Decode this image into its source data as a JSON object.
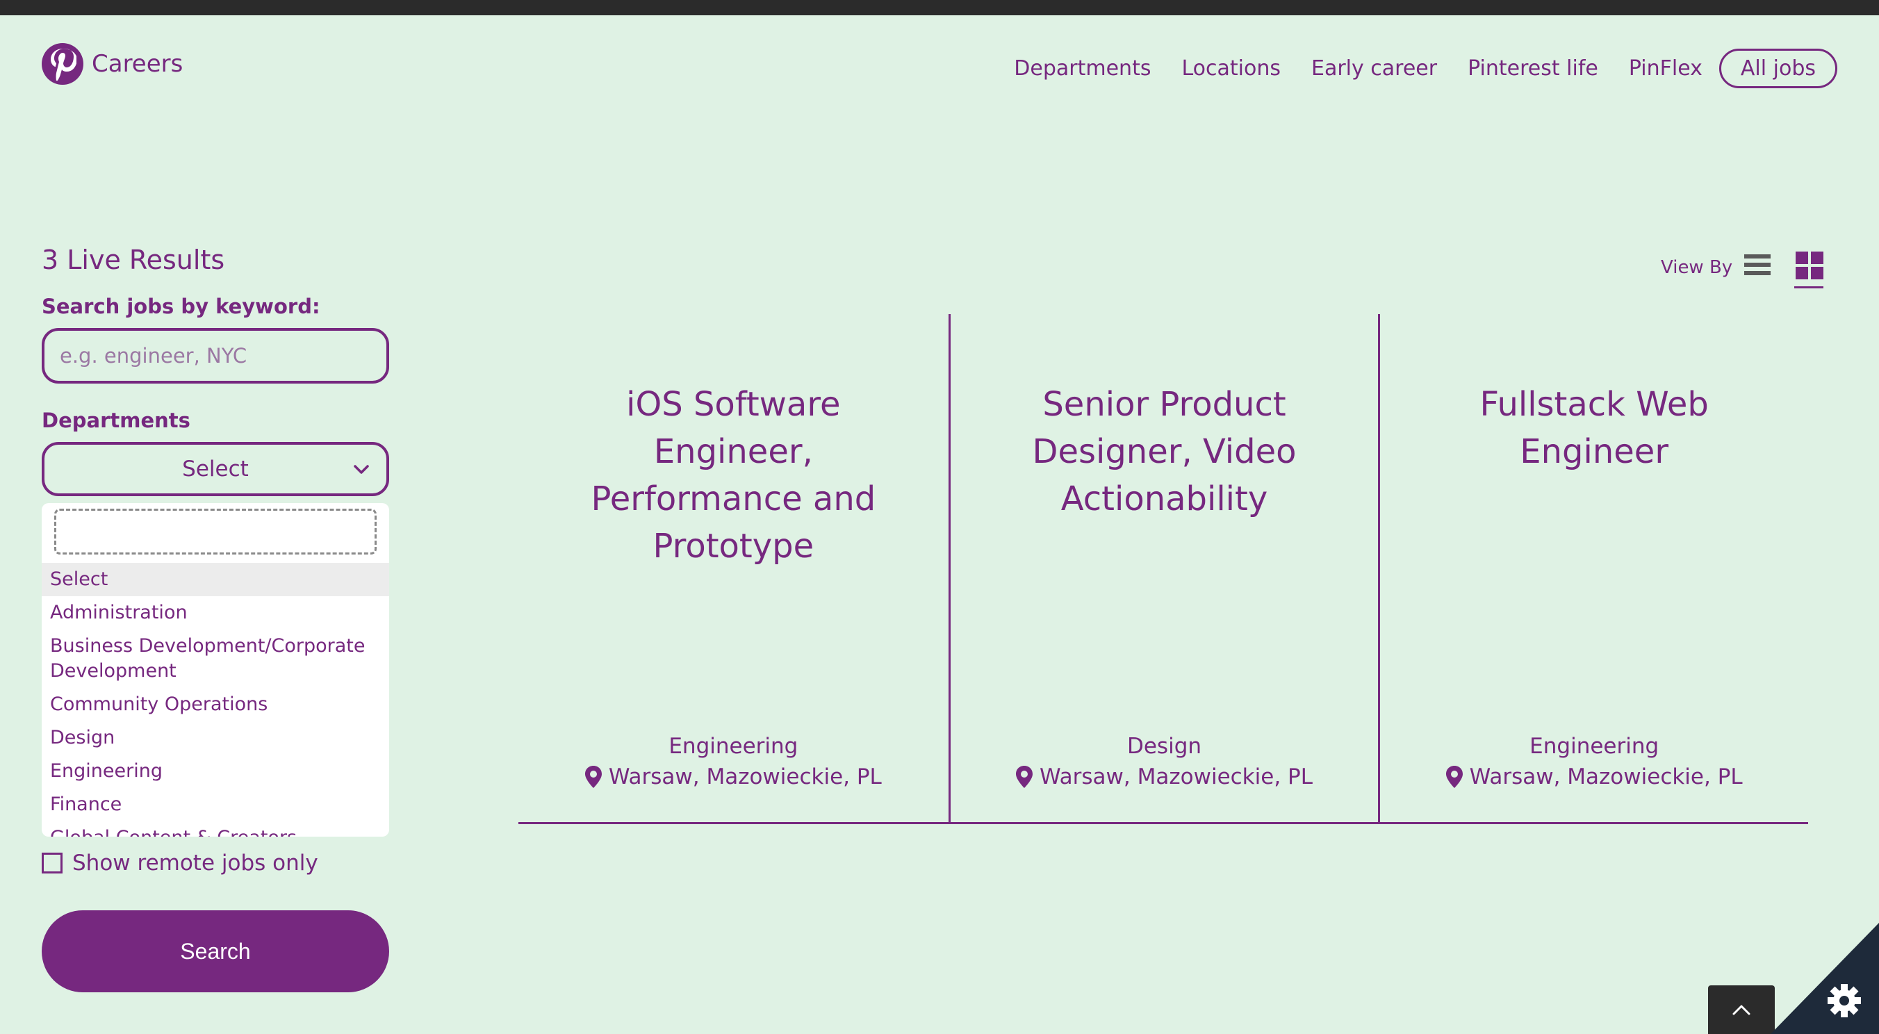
{
  "header": {
    "brand": "Careers",
    "nav": [
      "Departments",
      "Locations",
      "Early career",
      "Pinterest life",
      "PinFlex"
    ],
    "nav_pill": "All jobs"
  },
  "sidebar": {
    "results": "3 Live Results",
    "search_label": "Search jobs by keyword:",
    "search_placeholder": "e.g. engineer, NYC",
    "departments_label": "Departments",
    "select_value": "Select",
    "dropdown_options": [
      "Select",
      "Administration",
      "Business Development/Corporate Development",
      "Community Operations",
      "Design",
      "Engineering",
      "Finance",
      "Global Content & Creators"
    ],
    "remote_label": "Show remote jobs only",
    "search_button": "Search"
  },
  "view": {
    "label": "View By"
  },
  "jobs": [
    {
      "title": "iOS Software Engineer, Performance and Prototype",
      "department": "Engineering",
      "location": "Warsaw, Mazowieckie, PL"
    },
    {
      "title": "Senior Product Designer, Video Actionability",
      "department": "Design",
      "location": "Warsaw, Mazowieckie, PL"
    },
    {
      "title": "Fullstack Web Engineer",
      "department": "Engineering",
      "location": "Warsaw, Mazowieckie, PL"
    }
  ],
  "colors": {
    "brand": "#76287f",
    "background": "#dff2e4"
  }
}
